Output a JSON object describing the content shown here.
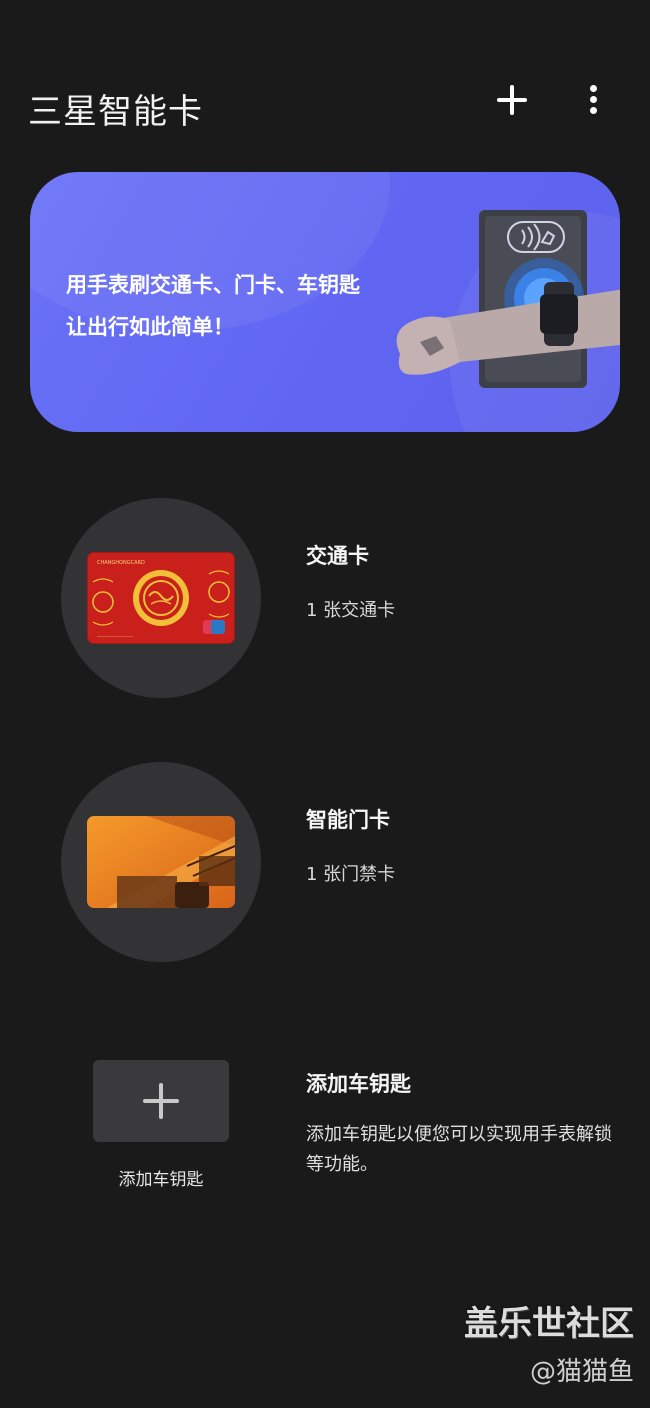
{
  "header": {
    "title": "三星智能卡",
    "add_icon": "plus-icon",
    "more_icon": "more-vertical-icon"
  },
  "banner": {
    "line1": "用手表刷交通卡、门卡、车钥匙",
    "line2": "让出行如此简单！",
    "colors": {
      "background": "#6066f2"
    }
  },
  "cards": [
    {
      "title": "交通卡",
      "subtitle": "1 张交通卡"
    },
    {
      "title": "智能门卡",
      "subtitle": "1 张门禁卡"
    }
  ],
  "car_key": {
    "box_label": "添加车钥匙",
    "title": "添加车钥匙",
    "description": "添加车钥匙以便您可以实现用手表解锁等功能。"
  },
  "watermark": {
    "main": "盖乐世社区",
    "sub": "@猫猫鱼"
  }
}
